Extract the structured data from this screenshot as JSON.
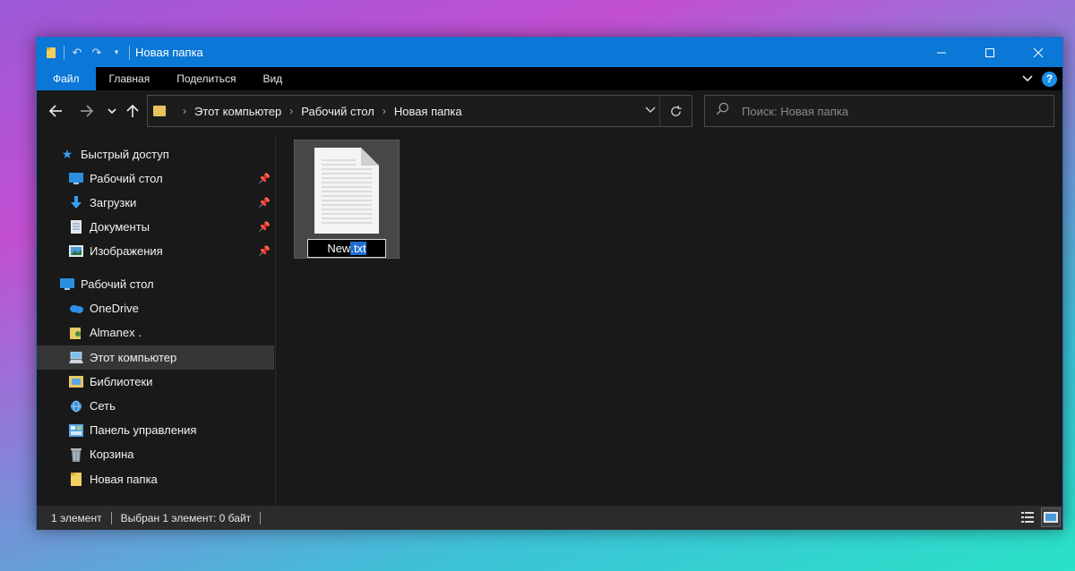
{
  "window": {
    "title": "Новая папка",
    "controls": [
      "minimize-icon",
      "maximize-icon",
      "close-icon"
    ]
  },
  "ribbon": {
    "tabs": [
      {
        "label": "Файл",
        "active": true
      },
      {
        "label": "Главная"
      },
      {
        "label": "Поделиться"
      },
      {
        "label": "Вид"
      }
    ],
    "help_label": "?"
  },
  "address": {
    "crumbs": [
      "Этот компьютер",
      "Рабочий стол",
      "Новая папка"
    ]
  },
  "search": {
    "placeholder": "Поиск: Новая папка"
  },
  "sidebar": {
    "quick_access": "Быстрый доступ",
    "pinned": [
      {
        "label": "Рабочий стол",
        "icon": "desktop-icon"
      },
      {
        "label": "Загрузки",
        "icon": "download-icon"
      },
      {
        "label": "Документы",
        "icon": "documents-icon"
      },
      {
        "label": "Изображения",
        "icon": "pictures-icon"
      }
    ],
    "tree": [
      {
        "label": "Рабочий стол",
        "icon": "desktop-icon"
      },
      {
        "label": "OneDrive",
        "icon": "onedrive-icon"
      },
      {
        "label": "Almanex .",
        "icon": "user-folder-icon"
      },
      {
        "label": "Этот компьютер",
        "icon": "this-pc-icon",
        "selected": true
      },
      {
        "label": "Библиотеки",
        "icon": "libraries-icon"
      },
      {
        "label": "Сеть",
        "icon": "network-icon"
      },
      {
        "label": "Панель управления",
        "icon": "control-panel-icon"
      },
      {
        "label": "Корзина",
        "icon": "recycle-bin-icon"
      },
      {
        "label": "Новая папка",
        "icon": "folder-icon"
      }
    ]
  },
  "file": {
    "name": "New",
    "extension": ".txt",
    "icon": "text-file-icon"
  },
  "status": {
    "count": "1 элемент",
    "selected": "Выбран 1 элемент: 0 байт"
  },
  "colors": {
    "accent": "#0b77d6",
    "background": "#191919",
    "selection": "#363636"
  }
}
